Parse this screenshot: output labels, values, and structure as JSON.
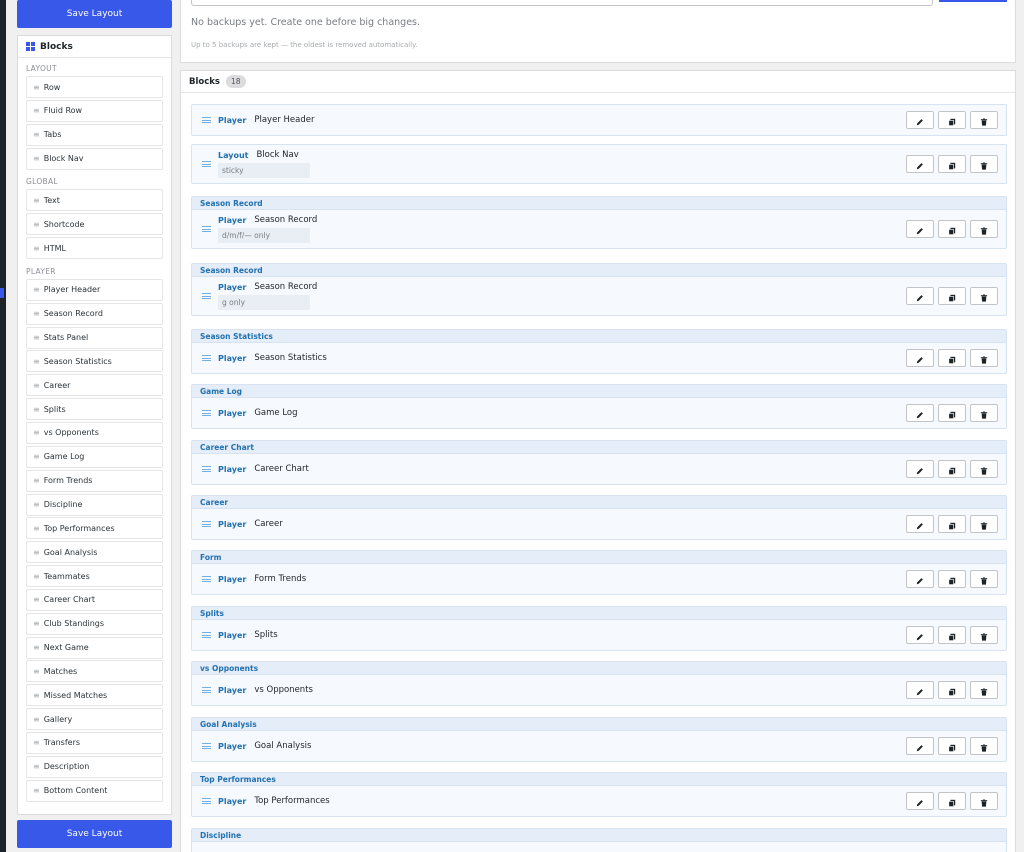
{
  "sidebar": {
    "save_label": "Save Layout",
    "panel_title": "Blocks",
    "groups": [
      {
        "label": "LAYOUT",
        "items": [
          "Row",
          "Fluid Row",
          "Tabs",
          "Block Nav"
        ]
      },
      {
        "label": "GLOBAL",
        "items": [
          "Text",
          "Shortcode",
          "HTML"
        ]
      },
      {
        "label": "PLAYER",
        "items": [
          "Player Header",
          "Season Record",
          "Stats Panel",
          "Season Statistics",
          "Career",
          "Splits",
          "vs Opponents",
          "Game Log",
          "Form Trends",
          "Discipline",
          "Top Performances",
          "Goal Analysis",
          "Teammates",
          "Career Chart",
          "Club Standings",
          "Next Game",
          "Matches",
          "Missed Matches",
          "Gallery",
          "Transfers",
          "Description",
          "Bottom Content"
        ]
      }
    ]
  },
  "backups": {
    "empty_text": "No backups yet. Create one before big changes.",
    "note": "Up to 5 backups are kept — the oldest is removed automatically."
  },
  "blocks": {
    "title": "Blocks",
    "count": "18",
    "items": [
      {
        "group": "",
        "type": "Player",
        "name": "Player Header",
        "tag": ""
      },
      {
        "group": "",
        "type": "Layout",
        "name": "Block Nav",
        "tag": "sticky"
      },
      {
        "group": "Season Record",
        "type": "Player",
        "name": "Season Record",
        "tag": "d/m/f/— only"
      },
      {
        "group": "Season Record",
        "type": "Player",
        "name": "Season Record",
        "tag": "g only"
      },
      {
        "group": "Season Statistics",
        "type": "Player",
        "name": "Season Statistics",
        "tag": ""
      },
      {
        "group": "Game Log",
        "type": "Player",
        "name": "Game Log",
        "tag": ""
      },
      {
        "group": "Career Chart",
        "type": "Player",
        "name": "Career Chart",
        "tag": ""
      },
      {
        "group": "Career",
        "type": "Player",
        "name": "Career",
        "tag": ""
      },
      {
        "group": "Form",
        "type": "Player",
        "name": "Form Trends",
        "tag": ""
      },
      {
        "group": "Splits",
        "type": "Player",
        "name": "Splits",
        "tag": ""
      },
      {
        "group": "vs Opponents",
        "type": "Player",
        "name": "vs Opponents",
        "tag": ""
      },
      {
        "group": "Goal Analysis",
        "type": "Player",
        "name": "Goal Analysis",
        "tag": ""
      },
      {
        "group": "Top Performances",
        "type": "Player",
        "name": "Top Performances",
        "tag": ""
      },
      {
        "group": "Discipline",
        "type": "",
        "name": "",
        "tag": ""
      }
    ]
  },
  "icons": {
    "edit": "pencil-icon",
    "duplicate": "copy-icon",
    "delete": "trash-icon",
    "drag": "drag-handle-icon",
    "blocks": "grid-icon"
  },
  "colors": {
    "accent": "#3858e9",
    "label_blue": "#2271b1"
  }
}
